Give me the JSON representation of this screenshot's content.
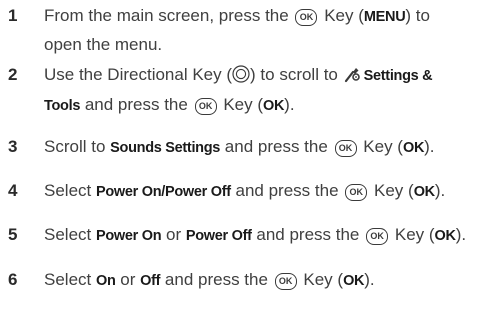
{
  "steps": [
    {
      "num": "1",
      "parts": [
        "From the main screen, press the",
        "Key (",
        "MENU",
        ") to",
        "open the menu."
      ]
    },
    {
      "num": "2",
      "parts": [
        "Use the Directional Key (",
        ") to scroll to",
        "Settings &",
        "Tools",
        "and press the",
        "Key (",
        "OK",
        ")."
      ]
    },
    {
      "num": "3",
      "parts": [
        "Scroll to",
        "Sounds Settings",
        "and press the",
        "Key (",
        "OK",
        ")."
      ]
    },
    {
      "num": "4",
      "parts": [
        "Select",
        "Power On/Power Off",
        "and press the",
        "Key (",
        "OK",
        ")."
      ]
    },
    {
      "num": "5",
      "parts": [
        "Select",
        "Power On",
        "or",
        "Power Off",
        "and press the",
        "Key (",
        "OK",
        ")."
      ]
    },
    {
      "num": "6",
      "parts": [
        "Select",
        "On",
        "or",
        "Off",
        "and press the",
        "Key (",
        "OK",
        ")."
      ]
    }
  ],
  "icons": {
    "ok_key": "OK",
    "ok_key_icon": "ok-key-icon",
    "directional_key_icon": "directional-key-icon",
    "settings_tools_icon": "settings-tools-icon"
  }
}
